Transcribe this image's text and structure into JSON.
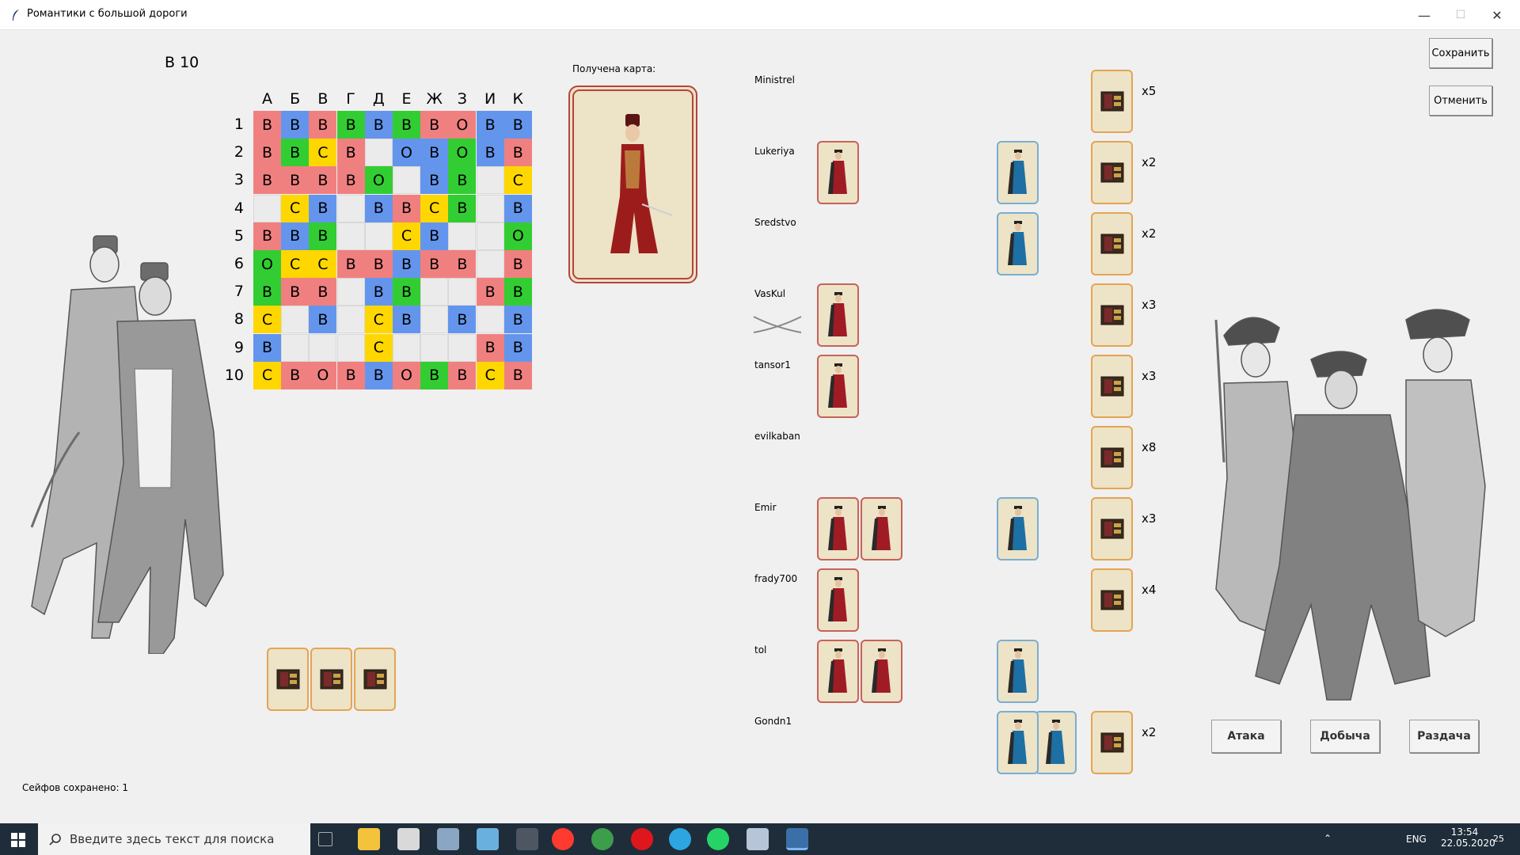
{
  "window": {
    "title": "Романтики с большой дороги",
    "minimize": "—",
    "maximize": "☐",
    "close": "✕"
  },
  "status": {
    "move": "В 10",
    "received_label": "Получена карта:",
    "safes_saved": "Сейфов сохранено: 1"
  },
  "grid": {
    "columns": [
      "А",
      "Б",
      "В",
      "Г",
      "Д",
      "Е",
      "Ж",
      "З",
      "И",
      "К"
    ],
    "rows": [
      "1",
      "2",
      "3",
      "4",
      "5",
      "6",
      "7",
      "8",
      "9",
      "10"
    ],
    "cells": [
      [
        [
          "В",
          "r"
        ],
        [
          "В",
          "b"
        ],
        [
          "В",
          "r"
        ],
        [
          "В",
          "g"
        ],
        [
          "В",
          "b"
        ],
        [
          "В",
          "g"
        ],
        [
          "В",
          "r"
        ],
        [
          "О",
          "r"
        ],
        [
          "В",
          "b"
        ],
        [
          "В",
          "b"
        ]
      ],
      [
        [
          "В",
          "r"
        ],
        [
          "В",
          "g"
        ],
        [
          "С",
          "y"
        ],
        [
          "В",
          "r"
        ],
        [
          "",
          "w"
        ],
        [
          "О",
          "b"
        ],
        [
          "В",
          "b"
        ],
        [
          "О",
          "g"
        ],
        [
          "В",
          "b"
        ],
        [
          "В",
          "r"
        ]
      ],
      [
        [
          "В",
          "r"
        ],
        [
          "В",
          "r"
        ],
        [
          "В",
          "r"
        ],
        [
          "В",
          "r"
        ],
        [
          "О",
          "g"
        ],
        [
          "",
          "w"
        ],
        [
          "В",
          "b"
        ],
        [
          "В",
          "g"
        ],
        [
          "",
          "w"
        ],
        [
          "С",
          "y"
        ]
      ],
      [
        [
          "",
          "w"
        ],
        [
          "С",
          "y"
        ],
        [
          "В",
          "b"
        ],
        [
          "",
          "w"
        ],
        [
          "В",
          "b"
        ],
        [
          "В",
          "r"
        ],
        [
          "С",
          "y"
        ],
        [
          "В",
          "g"
        ],
        [
          "",
          "w"
        ],
        [
          "В",
          "b"
        ]
      ],
      [
        [
          "В",
          "r"
        ],
        [
          "В",
          "b"
        ],
        [
          "В",
          "g"
        ],
        [
          "",
          "w"
        ],
        [
          "",
          "w"
        ],
        [
          "С",
          "y"
        ],
        [
          "В",
          "b"
        ],
        [
          "",
          "w"
        ],
        [
          "",
          "w"
        ],
        [
          "О",
          "g"
        ]
      ],
      [
        [
          "О",
          "g"
        ],
        [
          "С",
          "y"
        ],
        [
          "С",
          "y"
        ],
        [
          "В",
          "r"
        ],
        [
          "В",
          "r"
        ],
        [
          "В",
          "b"
        ],
        [
          "В",
          "r"
        ],
        [
          "В",
          "r"
        ],
        [
          "",
          "w"
        ],
        [
          "В",
          "r"
        ]
      ],
      [
        [
          "В",
          "g"
        ],
        [
          "В",
          "r"
        ],
        [
          "В",
          "r"
        ],
        [
          "",
          "w"
        ],
        [
          "В",
          "b"
        ],
        [
          "В",
          "g"
        ],
        [
          "",
          "w"
        ],
        [
          "",
          "w"
        ],
        [
          "В",
          "r"
        ],
        [
          "В",
          "g"
        ]
      ],
      [
        [
          "С",
          "y"
        ],
        [
          "",
          "w"
        ],
        [
          "В",
          "b"
        ],
        [
          "",
          "w"
        ],
        [
          "С",
          "y"
        ],
        [
          "В",
          "b"
        ],
        [
          "",
          "w"
        ],
        [
          "В",
          "b"
        ],
        [
          "",
          "w"
        ],
        [
          "В",
          "b"
        ]
      ],
      [
        [
          "В",
          "b"
        ],
        [
          "",
          "w"
        ],
        [
          "",
          "w"
        ],
        [
          "",
          "w"
        ],
        [
          "С",
          "y"
        ],
        [
          "",
          "w"
        ],
        [
          "",
          "w"
        ],
        [
          "",
          "w"
        ],
        [
          "В",
          "r"
        ],
        [
          "В",
          "b"
        ]
      ],
      [
        [
          "С",
          "y"
        ],
        [
          "В",
          "r"
        ],
        [
          "О",
          "r"
        ],
        [
          "В",
          "r"
        ],
        [
          "В",
          "b"
        ],
        [
          "О",
          "r"
        ],
        [
          "В",
          "g"
        ],
        [
          "В",
          "r"
        ],
        [
          "С",
          "y"
        ],
        [
          "В",
          "r"
        ]
      ]
    ]
  },
  "players": [
    {
      "name": "Ministrel",
      "red_cards": 0,
      "blue_cards": 0,
      "safes": "x5"
    },
    {
      "name": "Lukeriya",
      "red_cards": 1,
      "blue_cards": 1,
      "safes": "x2"
    },
    {
      "name": "Sredstvo",
      "red_cards": 0,
      "blue_cards": 1,
      "safes": "x2"
    },
    {
      "name": "VasKul",
      "red_cards": 1,
      "blue_cards": 0,
      "safes": "x3",
      "crossed_swords": true
    },
    {
      "name": "tansor1",
      "red_cards": 1,
      "blue_cards": 0,
      "safes": "x3"
    },
    {
      "name": "evilkaban",
      "red_cards": 0,
      "blue_cards": 0,
      "safes": "x8"
    },
    {
      "name": "Emir",
      "red_cards": 2,
      "blue_cards": 1,
      "safes": "x3"
    },
    {
      "name": "frady700",
      "red_cards": 1,
      "blue_cards": 0,
      "safes": "x4"
    },
    {
      "name": "tol",
      "red_cards": 2,
      "blue_cards": 1,
      "safes": ""
    },
    {
      "name": "Gondn1",
      "red_cards": 0,
      "blue_cards": 2,
      "safes": "x2"
    }
  ],
  "hand": {
    "safe_cards": 3
  },
  "buttons": {
    "save": "Сохранить",
    "cancel": "Отменить",
    "attack": "Атака",
    "loot": "Добыча",
    "deal": "Раздача"
  },
  "taskbar": {
    "search_placeholder": "Введите здесь текст для поиска",
    "lang": "ENG",
    "time": "13:54",
    "date": "22.05.2020",
    "notifications": "25"
  },
  "colors": {
    "red": "#f08080",
    "blue": "#6495ed",
    "green": "#32cd32",
    "yellow": "#ffd700",
    "empty": "#ebebeb",
    "safe_card_border": "#e4a453",
    "red_card_border": "#c7625a",
    "blue_card_border": "#7aaed1",
    "card_background": "#ede3c6"
  }
}
